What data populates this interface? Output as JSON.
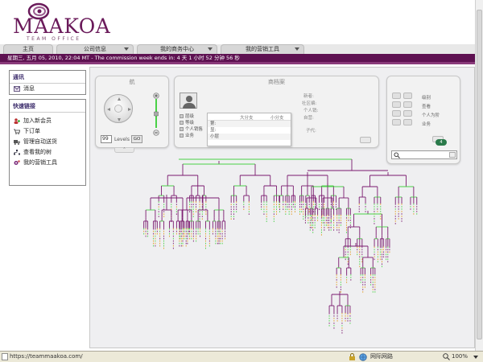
{
  "brand": {
    "name": "MAAKOA",
    "subtitle": "TEAM OFFICE"
  },
  "nav": {
    "tabs": [
      {
        "label": "主页"
      },
      {
        "label": "公司信息"
      },
      {
        "label": "我的商务中心"
      },
      {
        "label": "我的营销工具"
      }
    ]
  },
  "status": {
    "text": "星期三, 五月 05, 2010, 22:04 MT - The commission week ends in:  4 天 1 小时 52 分钟 56 秒"
  },
  "sidebar": {
    "notice": {
      "title": "通讯",
      "item": "消息"
    },
    "quicklinks": {
      "title": "快速链接",
      "items": [
        {
          "label": "加入新会员",
          "icon": "add-user-icon"
        },
        {
          "label": "下订单",
          "icon": "cart-icon"
        },
        {
          "label": "管理自动送货",
          "icon": "truck-icon"
        },
        {
          "label": "查看我的树",
          "icon": "tree-icon"
        },
        {
          "label": "我的营销工具",
          "icon": "tools-icon"
        }
      ]
    }
  },
  "navigator": {
    "title": "航",
    "levels_value": "99",
    "levels_label": "Levels",
    "go_label": "GO"
  },
  "profile": {
    "title": "商档案",
    "col1": "大分支",
    "col2": "小分支",
    "rows": [
      "第:",
      "显:",
      "小层"
    ],
    "labels": [
      "新者:",
      "社区编:",
      "个人销:",
      "自营:",
      "子代:"
    ],
    "checks": [
      "层级",
      "等级",
      "个人销售",
      "业务"
    ]
  },
  "search_panel": {
    "labels": [
      "级别",
      "查看",
      "个人为阶",
      "业务"
    ],
    "badge": "4"
  },
  "browser": {
    "url": "https://teammaakoa.com/",
    "zone": "网际网路",
    "zoom": "100%"
  },
  "colors": {
    "brand_purple": "#5e1151",
    "tree_green": "#49d146",
    "tree_purple": "#7a1a6e",
    "tree_orange": "#e09a20"
  }
}
